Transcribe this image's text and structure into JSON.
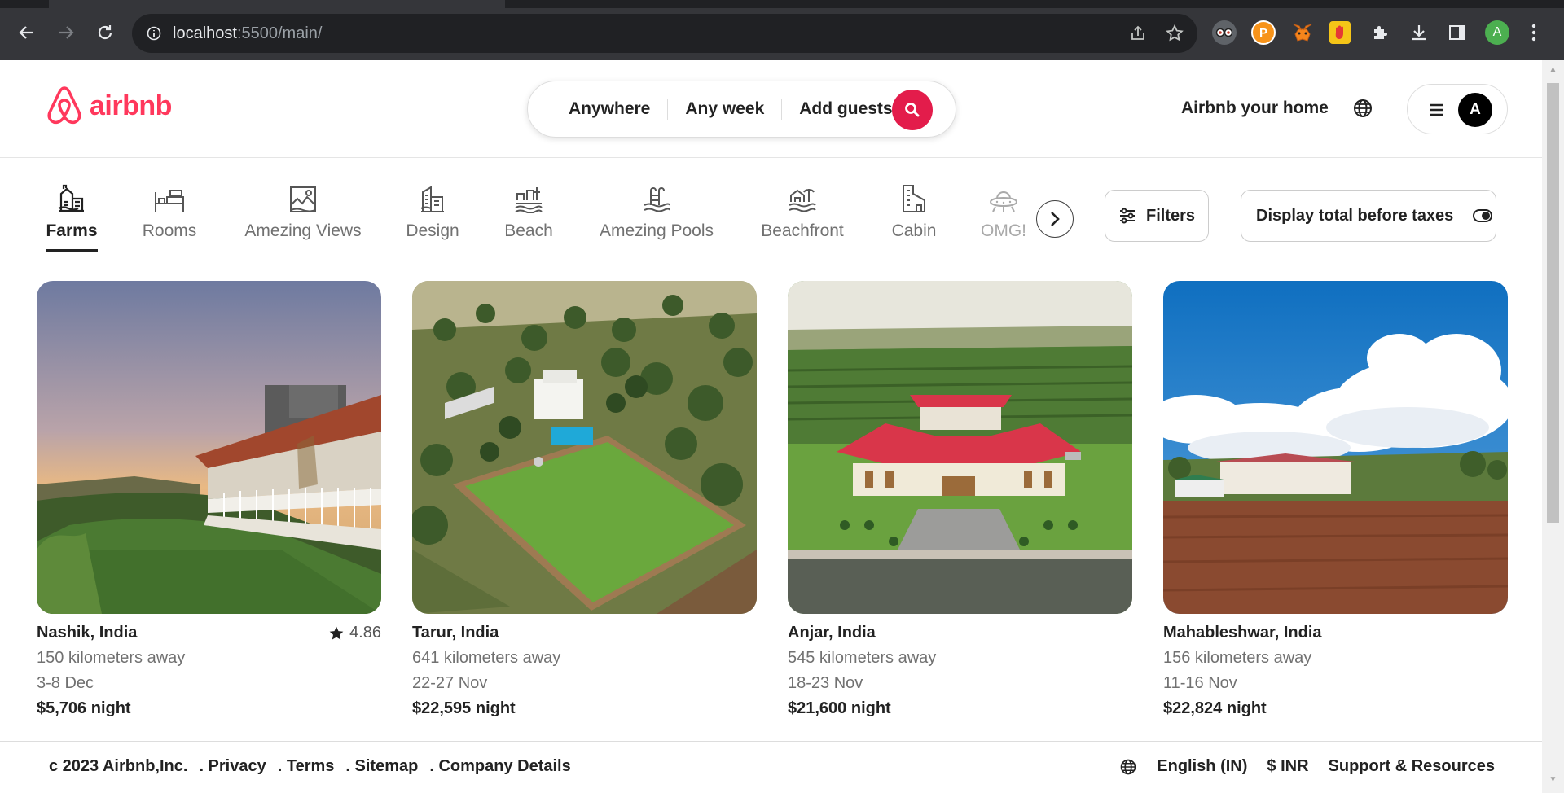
{
  "browser": {
    "url_host": "localhost",
    "url_rest": ":5500/main/",
    "profile_initial": "A"
  },
  "brand": {
    "name": "airbnb",
    "color": "#ff385c"
  },
  "search": {
    "where": "Anywhere",
    "when": "Any week",
    "who": "Add guests"
  },
  "header": {
    "host_link": "Airbnb your home",
    "avatar_initial": "A"
  },
  "categories": [
    {
      "label": "Farms",
      "icon": "farm-icon",
      "active": true
    },
    {
      "label": "Rooms",
      "icon": "bed-icon"
    },
    {
      "label": "Amezing Views",
      "icon": "landscape-icon"
    },
    {
      "label": "Design",
      "icon": "design-building-icon"
    },
    {
      "label": "Beach",
      "icon": "beach-icon"
    },
    {
      "label": "Amezing Pools",
      "icon": "pool-icon"
    },
    {
      "label": "Beachfront",
      "icon": "beachfront-icon"
    },
    {
      "label": "Cabin",
      "icon": "cabin-icon"
    },
    {
      "label": "OMG!",
      "icon": "ufo-icon"
    }
  ],
  "toolbar": {
    "filters_label": "Filters",
    "taxes_label": "Display total before taxes"
  },
  "listings": [
    {
      "location": "Nashik, India",
      "rating": "4.86",
      "distance": "150 kilometers away",
      "dates": "3-8 Dec",
      "price": "$5,706 night"
    },
    {
      "location": "Tarur, India",
      "rating": "",
      "distance": "641 kilometers away",
      "dates": "22-27 Nov",
      "price": "$22,595 night"
    },
    {
      "location": "Anjar, India",
      "rating": "",
      "distance": "545 kilometers away",
      "dates": "18-23 Nov",
      "price": "$21,600 night"
    },
    {
      "location": "Mahableshwar, India",
      "rating": "",
      "distance": "156 kilometers away",
      "dates": "11-16 Nov",
      "price": "$22,824 night"
    }
  ],
  "footer": {
    "copyright": "c 2023 Airbnb,Inc.",
    "privacy": ". Privacy",
    "terms": ". Terms",
    "sitemap": ". Sitemap",
    "company": ". Company Details",
    "language": "English (IN)",
    "currency": "$ INR",
    "support": "Support & Resources"
  }
}
